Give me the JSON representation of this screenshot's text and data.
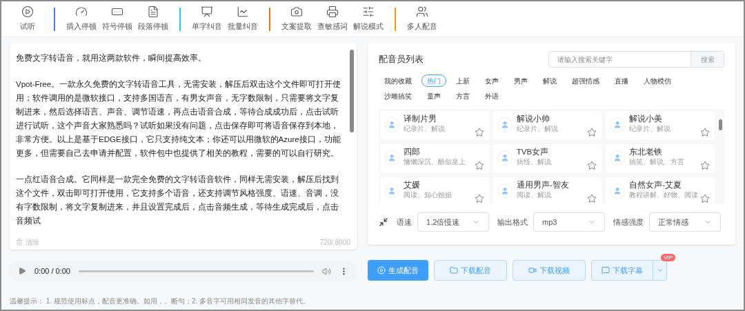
{
  "toolbar": [
    {
      "items": [
        {
          "label": "试听"
        }
      ]
    },
    {
      "items": [
        {
          "label": "插入停顿"
        },
        {
          "label": "符号停顿"
        },
        {
          "label": "段落停顿"
        }
      ]
    },
    {
      "items": [
        {
          "label": "单字纠音"
        },
        {
          "label": "批量纠音"
        }
      ]
    },
    {
      "items": [
        {
          "label": "文案提取"
        },
        {
          "label": "查敏感词"
        },
        {
          "label": "解说模式"
        }
      ]
    },
    {
      "items": [
        {
          "label": "多人配音"
        }
      ]
    }
  ],
  "editor": {
    "paragraphs": [
      "免费文字转语音，就用这两款软件，瞬间提高效率。",
      "Vpot-Free。一款永久免费的文字转语音工具，无需安装，解压后双击这个文件即可打开使用；软件调用的是微软接口，支持多国语言，有男女声音，无字数限制，只需要将文字复制进来，然后选择语言、声音、调节语速，再点击语音合成，等待合成成功后，点击试听进行试听，这个声音大家熟悉吗？试听如果没有问题，点击保存即可将语音保存到本地，非常方便。以上是基于EDGE接口，它只支持纯文本；你还可以用微软的Azure接口，功能更多，但需要自己去申请并配置，软件包中也提供了相关的教程，需要的可以自行研究。",
      "一点红语音合成。它同样是一款完全免费的文字转语音软件，同样无需安装，解压后找到这个文件，双击即可打开使用，它支持多个语音，还支持调节风格强度、语速、音调，没有字数限制，将文字复制进来，并且设置完成后，点击音频生成，等待生成完成后，点击音频试"
    ],
    "clear": "清除",
    "count": "720/ 8000"
  },
  "player": {
    "time": "0:00 / 0:00"
  },
  "voices": {
    "title": "配音员列表",
    "search_placeholder": "请输入搜索关键字",
    "search_button": "搜索",
    "categories": [
      {
        "label": "我的收藏",
        "selected": false
      },
      {
        "label": "热门",
        "selected": true
      },
      {
        "label": "上新",
        "selected": false
      },
      {
        "label": "女声",
        "selected": false
      },
      {
        "label": "男声",
        "selected": false
      },
      {
        "label": "解说",
        "selected": false
      },
      {
        "label": "超强情感",
        "selected": false
      },
      {
        "label": "直播",
        "selected": false
      },
      {
        "label": "人物模仿",
        "selected": false
      },
      {
        "label": "沙雕搞笑",
        "selected": false
      },
      {
        "label": "童声",
        "selected": false
      },
      {
        "label": "方言",
        "selected": false
      },
      {
        "label": "外语",
        "selected": false
      }
    ],
    "cards": [
      {
        "name": "译制片男",
        "tags": "纪录片、解说"
      },
      {
        "name": "解说小帅",
        "tags": "纪录片、解说"
      },
      {
        "name": "解说小美",
        "tags": "纪录片、解说"
      },
      {
        "name": "四郎",
        "tags": "慵懒深沉、酷似皇上"
      },
      {
        "name": "TVB女声",
        "tags": "搞怪、解说"
      },
      {
        "name": "东北老铁",
        "tags": "搞笑、解说、方言"
      },
      {
        "name": "艾媛",
        "tags": "阅读、知心姐姐"
      },
      {
        "name": "通用男声-智友",
        "tags": "阅读、解说"
      },
      {
        "name": "自然女声-艾夏",
        "tags": "教程讲解、好物、阅读"
      }
    ],
    "settings": [
      {
        "label": "语速",
        "value": "1.2倍慢速"
      },
      {
        "label": "输出格式",
        "value": "mp3"
      },
      {
        "label": "情感强度",
        "value": "正常情感"
      }
    ]
  },
  "actions": {
    "generate": "生成配音",
    "download_audio": "下载配音",
    "download_video": "下载视频",
    "download_subtitles": "下载字幕",
    "badge": "VIP"
  },
  "tip": "温馨提示： 1. 规范使用标点，配音更准确。如用，。断句；2. 多音字可用相同发音的其他字替代。"
}
